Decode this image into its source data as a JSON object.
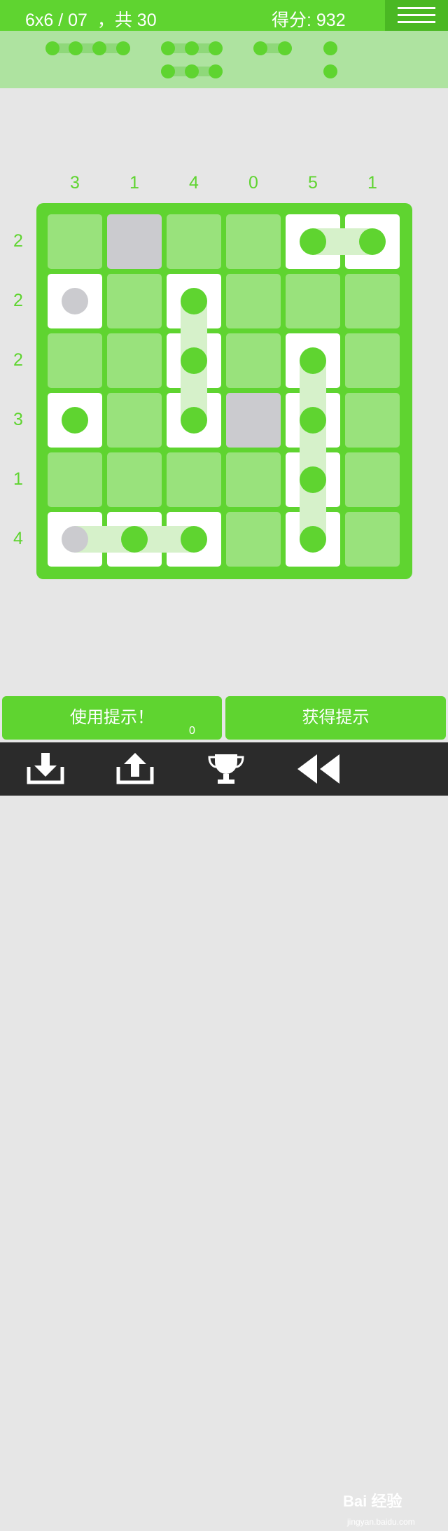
{
  "header": {
    "level_text": "6x6 / 07  ，共 30",
    "score_text": "得分: 932"
  },
  "colors": {
    "accent": "#5fd430",
    "cell": "#99e27c",
    "water": "#cbcbcf",
    "ship_cell": "#ffffff"
  },
  "fleet": [
    {
      "length": 4,
      "count": 1
    },
    {
      "length": 3,
      "count": 2
    },
    {
      "length": 2,
      "count": 1
    },
    {
      "length": 1,
      "count": 2
    }
  ],
  "board": {
    "size": 6,
    "column_clues": [
      "3",
      "1",
      "4",
      "0",
      "5",
      "1"
    ],
    "row_clues": [
      "2",
      "2",
      "2",
      "3",
      "1",
      "4"
    ],
    "cells": [
      [
        "empty",
        "water",
        "empty",
        "empty",
        "ship",
        "ship"
      ],
      [
        "ship",
        "empty",
        "ship",
        "empty",
        "empty",
        "empty"
      ],
      [
        "empty",
        "empty",
        "ship",
        "empty",
        "ship",
        "empty"
      ],
      [
        "ship",
        "empty",
        "ship",
        "water",
        "ship",
        "empty"
      ],
      [
        "empty",
        "empty",
        "empty",
        "empty",
        "ship",
        "empty"
      ],
      [
        "ship",
        "ship",
        "ship",
        "empty",
        "ship",
        "empty"
      ]
    ],
    "pegs": [
      {
        "row": 0,
        "col": 4,
        "color": "green"
      },
      {
        "row": 0,
        "col": 5,
        "color": "green"
      },
      {
        "row": 1,
        "col": 0,
        "color": "grey"
      },
      {
        "row": 1,
        "col": 2,
        "color": "green"
      },
      {
        "row": 2,
        "col": 2,
        "color": "green"
      },
      {
        "row": 2,
        "col": 4,
        "color": "green"
      },
      {
        "row": 3,
        "col": 0,
        "color": "green"
      },
      {
        "row": 3,
        "col": 2,
        "color": "green"
      },
      {
        "row": 3,
        "col": 4,
        "color": "green"
      },
      {
        "row": 4,
        "col": 4,
        "color": "green"
      },
      {
        "row": 5,
        "col": 0,
        "color": "grey"
      },
      {
        "row": 5,
        "col": 1,
        "color": "green"
      },
      {
        "row": 5,
        "col": 2,
        "color": "green"
      },
      {
        "row": 5,
        "col": 4,
        "color": "green"
      }
    ],
    "connections": [
      {
        "from": [
          0,
          4
        ],
        "to": [
          0,
          5
        ]
      },
      {
        "from": [
          1,
          2
        ],
        "to": [
          3,
          2
        ]
      },
      {
        "from": [
          2,
          4
        ],
        "to": [
          5,
          4
        ]
      },
      {
        "from": [
          5,
          0
        ],
        "to": [
          5,
          2
        ]
      }
    ]
  },
  "buttons": {
    "use_hint": "使用提示！",
    "hint_count": "0",
    "get_hint": "获得提示"
  },
  "toolbar": {
    "icons": [
      "download-icon",
      "upload-icon",
      "trophy-icon",
      "rewind-icon"
    ]
  },
  "watermark": {
    "logo": "Bai 经验",
    "url": "jingyan.baidu.com"
  }
}
